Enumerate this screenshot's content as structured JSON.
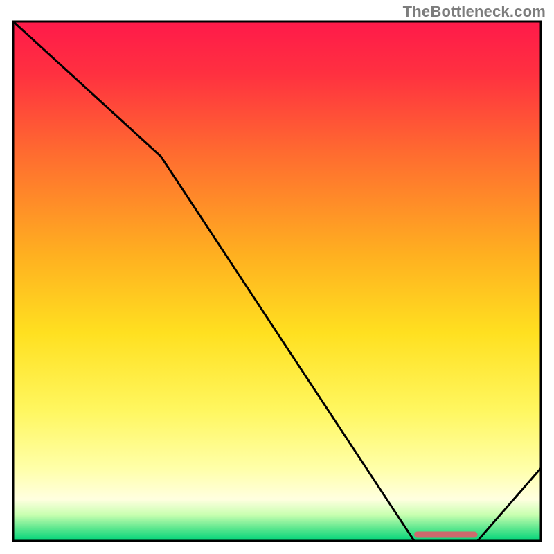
{
  "watermark": "TheBottleneck.com",
  "chart_data": {
    "type": "line",
    "title": "",
    "xlabel": "",
    "ylabel": "",
    "xlim": [
      0,
      100
    ],
    "ylim": [
      0,
      100
    ],
    "x": [
      0,
      28,
      76,
      80,
      88,
      100
    ],
    "values": [
      100,
      74,
      0,
      0,
      0,
      14
    ],
    "optimum_band": {
      "x_start": 76,
      "x_end": 88,
      "color": "#cd6a6d"
    },
    "gradient_stops": [
      {
        "offset": 0.0,
        "color": "#ff1a4a"
      },
      {
        "offset": 0.1,
        "color": "#ff3040"
      },
      {
        "offset": 0.25,
        "color": "#ff6a30"
      },
      {
        "offset": 0.45,
        "color": "#ffb020"
      },
      {
        "offset": 0.6,
        "color": "#ffe020"
      },
      {
        "offset": 0.75,
        "color": "#fff760"
      },
      {
        "offset": 0.86,
        "color": "#ffffa8"
      },
      {
        "offset": 0.92,
        "color": "#ffffe0"
      },
      {
        "offset": 0.95,
        "color": "#c8ffb0"
      },
      {
        "offset": 0.975,
        "color": "#60e890"
      },
      {
        "offset": 1.0,
        "color": "#00d47a"
      }
    ],
    "grid": false,
    "legend": false,
    "border_color": "#000000"
  },
  "plot": {
    "inner_x": 19,
    "inner_y": 31,
    "inner_w": 762,
    "inner_h": 750,
    "line_width": 3,
    "border_width": 3,
    "band_y_frac": 0.988,
    "band_height": 9
  }
}
